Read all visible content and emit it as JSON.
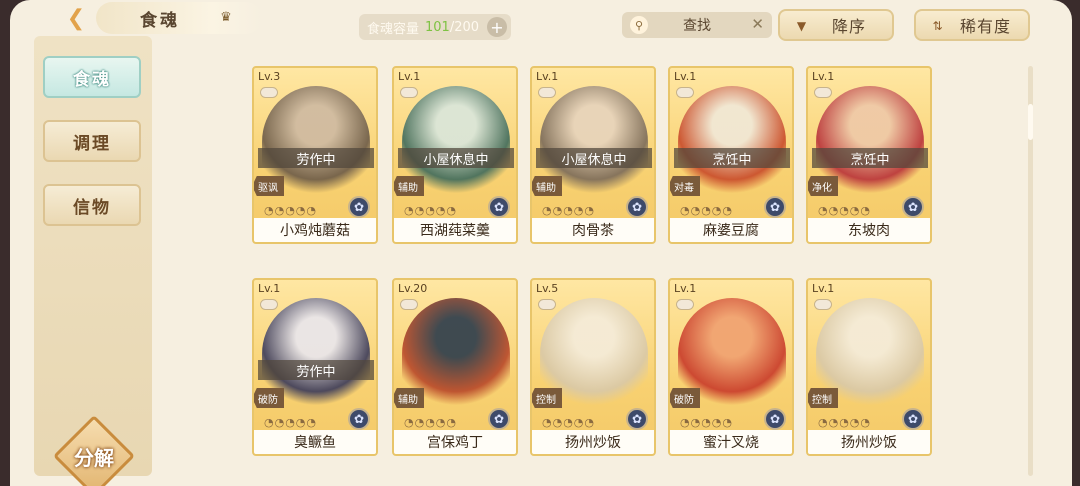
{
  "header": {
    "title": "食魂",
    "capacity_label": "食魂容量",
    "capacity_current": "101",
    "capacity_sep": "/",
    "capacity_max": "200",
    "search_placeholder": "查找",
    "sort_desc_label": "降序",
    "sort_rarity_label": "稀有度"
  },
  "sidebar": {
    "tabs": [
      {
        "label": "食魂",
        "active": true
      },
      {
        "label": "调理",
        "active": false
      },
      {
        "label": "信物",
        "active": false
      }
    ],
    "decompose_label": "分解"
  },
  "cards": [
    {
      "level": "Lv.3",
      "status": "劳作中",
      "role": "驱讽",
      "name": "小鸡炖蘑菇",
      "art_colors": [
        "#6b5a48",
        "#cdb9a2"
      ]
    },
    {
      "level": "Lv.1",
      "status": "小屋休息中",
      "role": "辅助",
      "name": "西湖莼菜羹",
      "art_colors": [
        "#3e6a5c",
        "#d8e6dc"
      ]
    },
    {
      "level": "Lv.1",
      "status": "小屋休息中",
      "role": "辅助",
      "name": "肉骨茶",
      "art_colors": [
        "#7a6a5a",
        "#e6d3bd"
      ]
    },
    {
      "level": "Lv.1",
      "status": "烹饪中",
      "role": "对毒",
      "name": "麻婆豆腐",
      "art_colors": [
        "#c84a2a",
        "#f0e8d8"
      ]
    },
    {
      "level": "Lv.1",
      "status": "烹饪中",
      "role": "净化",
      "name": "东坡肉",
      "art_colors": [
        "#b8323a",
        "#eec8a8"
      ]
    },
    {
      "level": "Lv.1",
      "status": "劳作中",
      "role": "破防",
      "name": "臭鳜鱼",
      "art_colors": [
        "#3a3a5a",
        "#e8e6ee"
      ]
    },
    {
      "level": "Lv.20",
      "status": "",
      "role": "辅助",
      "name": "宫保鸡丁",
      "art_colors": [
        "#b8482a",
        "#2a3a4a"
      ]
    },
    {
      "level": "Lv.5",
      "status": "",
      "role": "控制",
      "name": "扬州炒饭",
      "art_colors": [
        "#d8c8a8",
        "#f4ecdc"
      ]
    },
    {
      "level": "Lv.1",
      "status": "",
      "role": "破防",
      "name": "蜜汁叉烧",
      "art_colors": [
        "#c83a2a",
        "#f0a070"
      ]
    },
    {
      "level": "Lv.1",
      "status": "",
      "role": "控制",
      "name": "扬州炒饭",
      "art_colors": [
        "#d8c8a8",
        "#f4ecdc"
      ]
    }
  ],
  "icons": {
    "back": "chevron-left-icon",
    "crown": "crown-icon",
    "search": "search-icon",
    "clear": "close-icon",
    "sort_desc": "triangle-down-icon",
    "sort_rarity": "sort-arrows-icon"
  },
  "colors": {
    "accent": "#e2a24a",
    "active_tab": "#c5e8e2",
    "capacity_current": "#7ec243"
  }
}
